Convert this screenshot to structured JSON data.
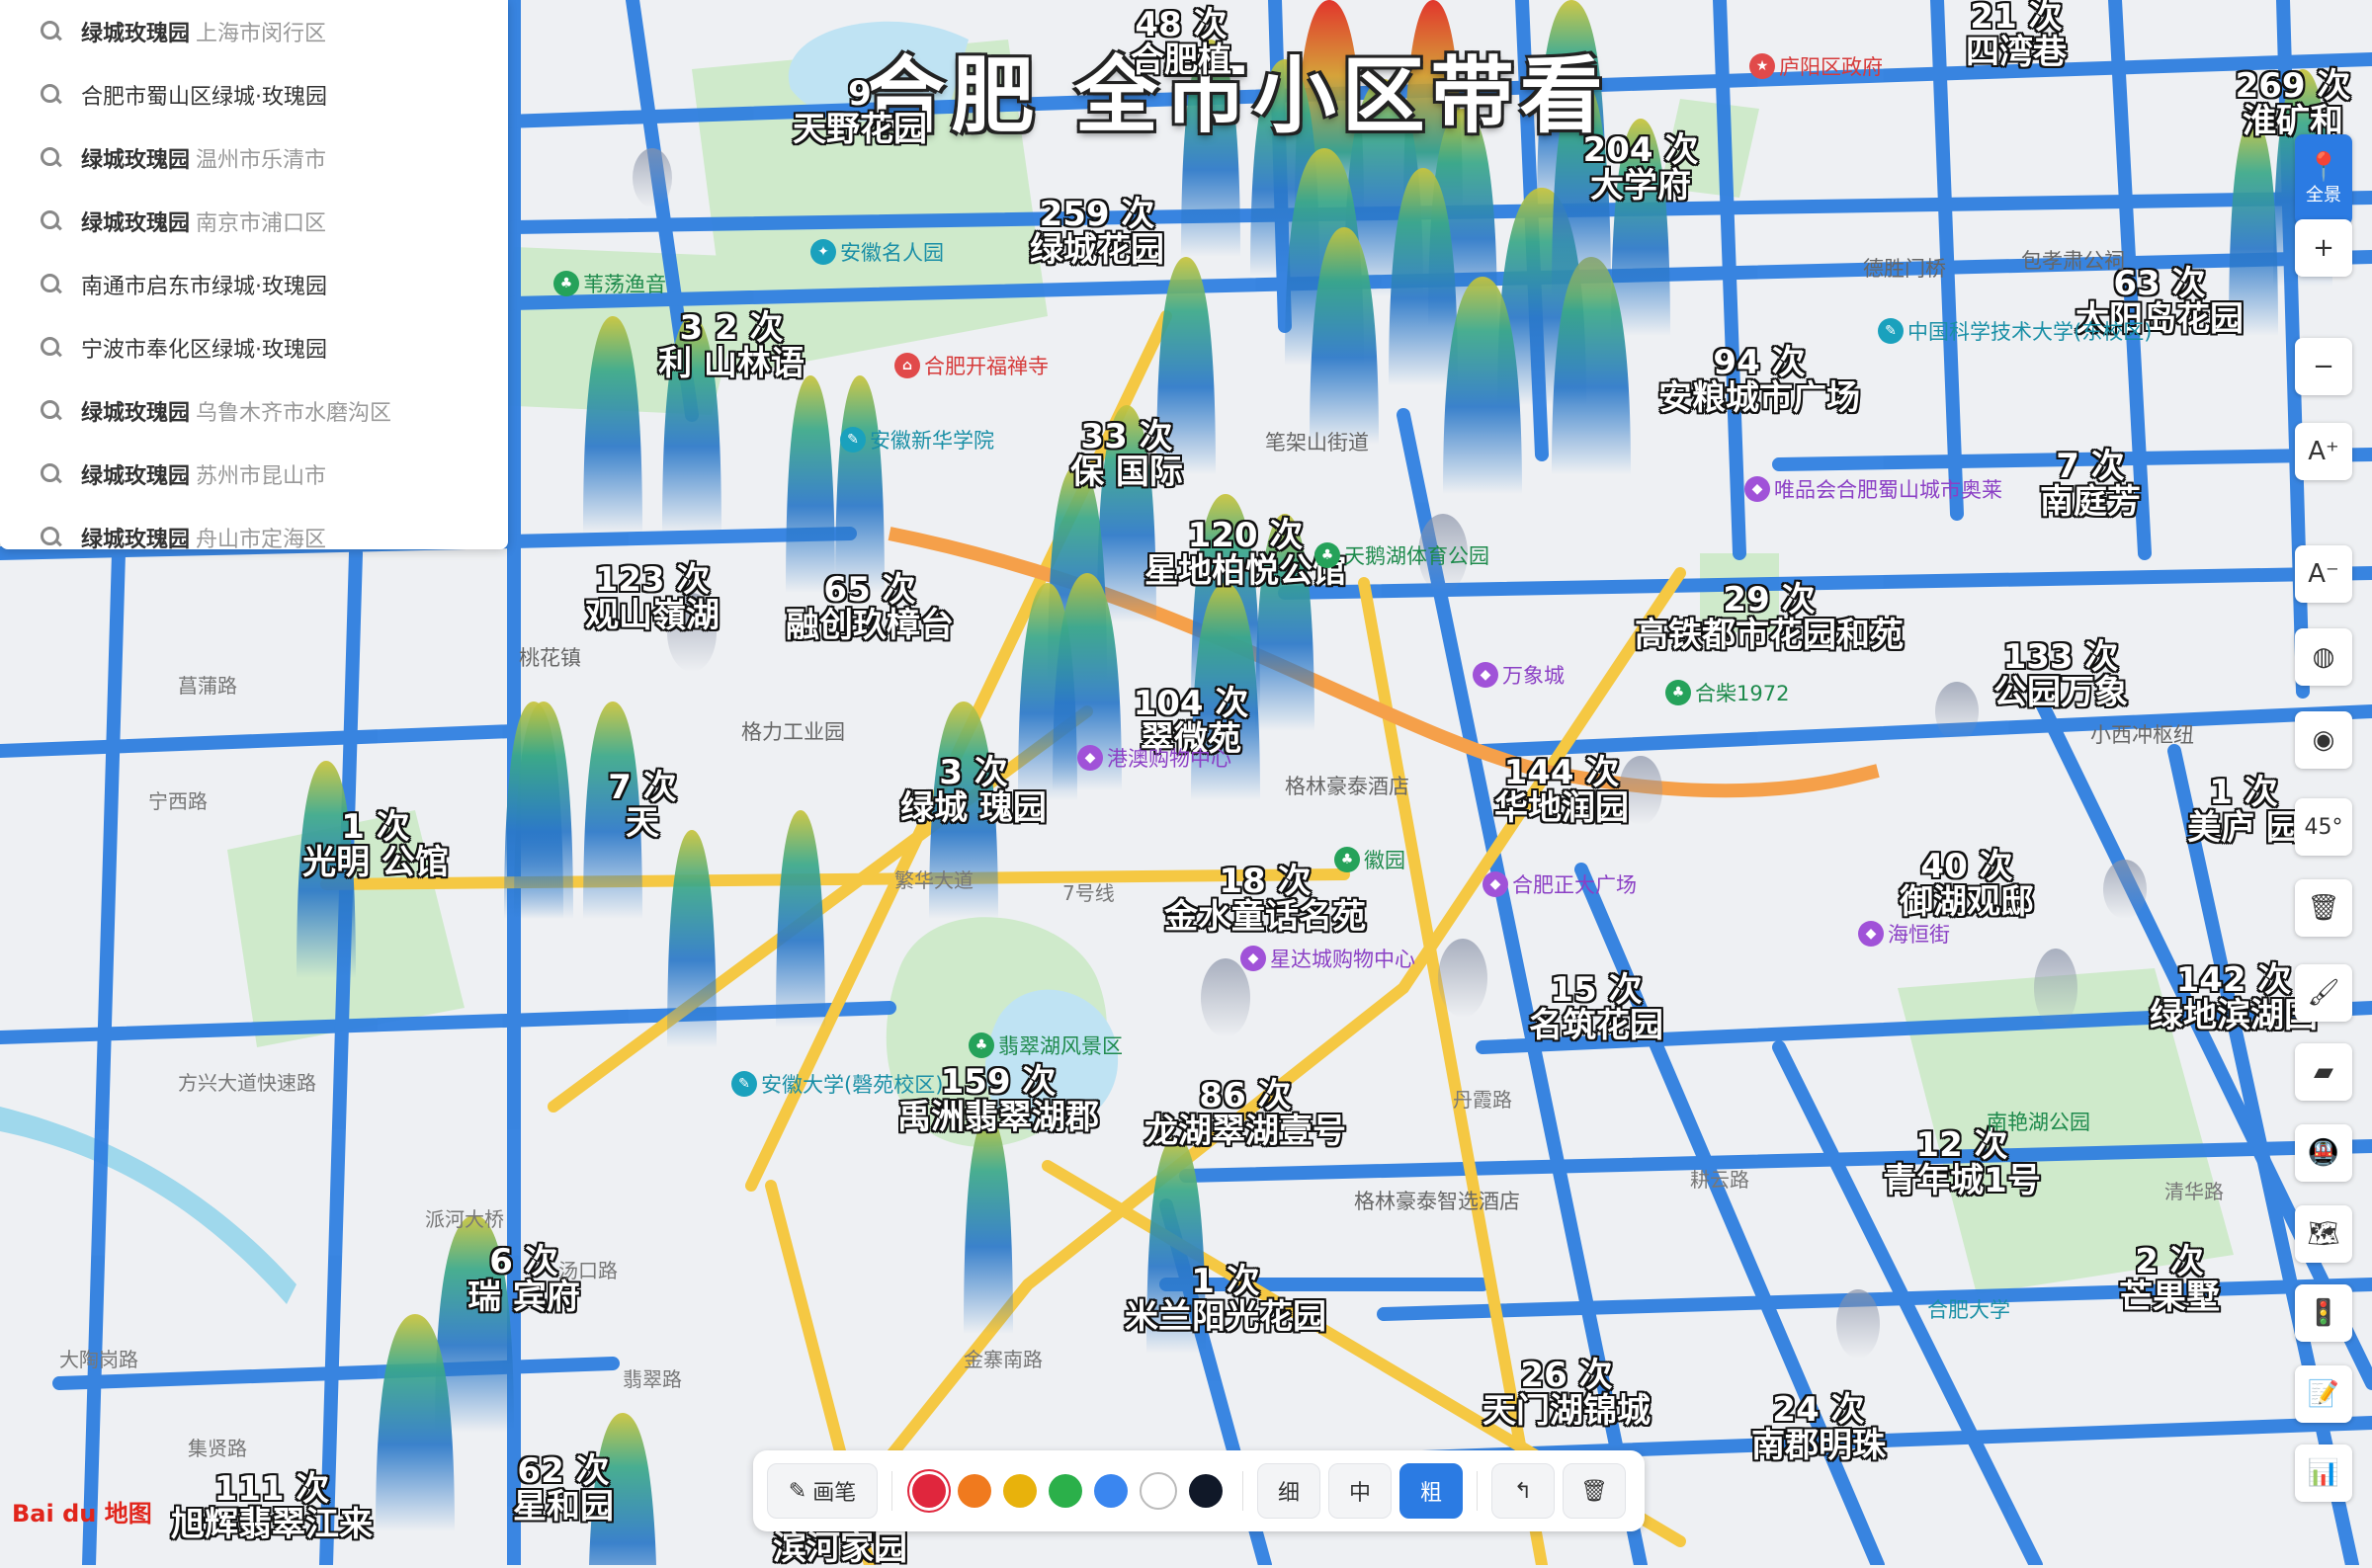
{
  "title": "合肥 全市小区带看",
  "search_suggestions": [
    {
      "bold": "绿城玫瑰园",
      "rest": "上海市闵行区"
    },
    {
      "bold": "",
      "rest": "合肥市蜀山区绿城·玫瑰园"
    },
    {
      "bold": "绿城玫瑰园",
      "rest": "温州市乐清市"
    },
    {
      "bold": "绿城玫瑰园",
      "rest": "南京市浦口区"
    },
    {
      "bold": "",
      "rest": "南通市启东市绿城·玫瑰园"
    },
    {
      "bold": "",
      "rest": "宁波市奉化区绿城·玫瑰园"
    },
    {
      "bold": "绿城玫瑰园",
      "rest": "乌鲁木齐市水磨沟区"
    },
    {
      "bold": "绿城玫瑰园",
      "rest": "苏州市昆山市"
    },
    {
      "bold": "绿城玫瑰园",
      "rest": "舟山市定海区"
    }
  ],
  "labels": [
    {
      "count": "48 次",
      "name": "合肥植"
    },
    {
      "count": "9",
      "name": "天野花园"
    },
    {
      "count": "21 次",
      "name": "四湾巷"
    },
    {
      "count": "269 次",
      "name": "淮矿和"
    },
    {
      "count": "204 次",
      "name": "大学府"
    },
    {
      "count": "259 次",
      "name": "绿城花园"
    },
    {
      "count": "3 2 次",
      "name": "利 山林语"
    },
    {
      "count": "63 次",
      "name": "太阳岛花园"
    },
    {
      "count": "94 次",
      "name": "安粮城市广场"
    },
    {
      "count": "33 次",
      "name": "保 国际"
    },
    {
      "count": "7 次",
      "name": "南庭芳"
    },
    {
      "count": "120 次",
      "name": "星地柏悦公馆"
    },
    {
      "count": "123 次",
      "name": "观山嶺湖"
    },
    {
      "count": "65 次",
      "name": "融创玖樟台"
    },
    {
      "count": "29 次",
      "name": "高铁都市花园和苑"
    },
    {
      "count": "133 次",
      "name": "公园万象"
    },
    {
      "count": "104 次",
      "name": "翠微苑"
    },
    {
      "count": "3 次",
      "name": "绿城 瑰园"
    },
    {
      "count": "144 次",
      "name": "华地润园"
    },
    {
      "count": "1 次",
      "name": "美庐 园"
    },
    {
      "count": "1 次",
      "name": "光明 公馆"
    },
    {
      "count": "7 次",
      "name": "天"
    },
    {
      "count": "18 次",
      "name": "金水童话名苑"
    },
    {
      "count": "40 次",
      "name": "御湖观邸"
    },
    {
      "count": "142 次",
      "name": "绿地滨湖国"
    },
    {
      "count": "15 次",
      "name": "名筑花园"
    },
    {
      "count": "159 次",
      "name": "禹洲翡翠湖郡"
    },
    {
      "count": "86 次",
      "name": "龙湖翠湖壹号"
    },
    {
      "count": "12 次",
      "name": "青年城1号"
    },
    {
      "count": "6 次",
      "name": "瑞 宾府"
    },
    {
      "count": "1 次",
      "name": "米兰阳光花园"
    },
    {
      "count": "2 次",
      "name": "芒果墅"
    },
    {
      "count": "26 次",
      "name": "天门湖锦城"
    },
    {
      "count": "24 次",
      "name": "南郡明珠"
    },
    {
      "count": "111 次",
      "name": "旭辉翡翠江来"
    },
    {
      "count": "62 次",
      "name": "星和园"
    },
    {
      "count": "",
      "name": "滨河家园"
    }
  ],
  "pois": [
    {
      "type": "gov",
      "icon": "★",
      "name": "庐阳区政府"
    },
    {
      "type": "edu",
      "icon": "✦",
      "name": "安徽名人园"
    },
    {
      "type": "park",
      "icon": "♣",
      "name": "苇荡渔音"
    },
    {
      "type": "gov",
      "icon": "⌂",
      "name": "合肥开福禅寺"
    },
    {
      "type": "edu",
      "icon": "✎",
      "name": "中国科学技术大学(东校区)"
    },
    {
      "type": "edu",
      "icon": "✎",
      "name": "安徽新华学院"
    },
    {
      "type": "shop",
      "icon": "◆",
      "name": "唯品会合肥蜀山城市奥莱"
    },
    {
      "type": "park",
      "icon": "♣",
      "name": "天鹅湖体育公园"
    },
    {
      "type": "shop",
      "icon": "◆",
      "name": "万象城"
    },
    {
      "type": "park",
      "icon": "♣",
      "name": "合柴1972"
    },
    {
      "type": "plain",
      "icon": "",
      "name": "格力工业园"
    },
    {
      "type": "shop",
      "icon": "◆",
      "name": "港澳购物中心"
    },
    {
      "type": "plain",
      "icon": "",
      "name": "格林豪泰酒店"
    },
    {
      "type": "park",
      "icon": "♣",
      "name": "徽园"
    },
    {
      "type": "shop",
      "icon": "◆",
      "name": "合肥正大广场"
    },
    {
      "type": "shop",
      "icon": "◆",
      "name": "星达城购物中心"
    },
    {
      "type": "shop",
      "icon": "◆",
      "name": "海恒街"
    },
    {
      "type": "park",
      "icon": "♣",
      "name": "翡翠湖风景区"
    },
    {
      "type": "edu",
      "icon": "✎",
      "name": "安徽大学(磬苑校区)"
    },
    {
      "type": "plain",
      "icon": "",
      "name": "格林豪泰智选酒店"
    },
    {
      "type": "park",
      "icon": "",
      "name": "南艳湖公园"
    },
    {
      "type": "edu",
      "icon": "",
      "name": "合肥大学"
    },
    {
      "type": "plain",
      "icon": "",
      "name": "笔架山街道"
    },
    {
      "type": "plain",
      "icon": "",
      "name": "桃花镇"
    },
    {
      "type": "plain",
      "icon": "",
      "name": "德胜门桥"
    },
    {
      "type": "plain",
      "icon": "",
      "name": "包孝肃公祠"
    },
    {
      "type": "plain",
      "icon": "",
      "name": "小西冲枢纽"
    },
    {
      "type": "road",
      "icon": "",
      "name": "繁华大道"
    },
    {
      "type": "road",
      "icon": "",
      "name": "丹霞路"
    },
    {
      "type": "road",
      "icon": "",
      "name": "耕云路"
    },
    {
      "type": "road",
      "icon": "",
      "name": "清华路"
    },
    {
      "type": "road",
      "icon": "",
      "name": "宁西路"
    },
    {
      "type": "road",
      "icon": "",
      "name": "菖蒲路"
    },
    {
      "type": "road",
      "icon": "",
      "name": "金寨南路"
    },
    {
      "type": "road",
      "icon": "",
      "name": "翡翠路"
    },
    {
      "type": "road",
      "icon": "",
      "name": "汤口路"
    },
    {
      "type": "road",
      "icon": "",
      "name": "派河大桥"
    },
    {
      "type": "road",
      "icon": "",
      "name": "大陶岗路"
    },
    {
      "type": "road",
      "icon": "",
      "name": "集贤路"
    },
    {
      "type": "road",
      "icon": "",
      "name": "方兴大道快速路"
    },
    {
      "type": "road",
      "icon": "",
      "name": "7号线"
    }
  ],
  "controls": {
    "full_view": "全景",
    "zoom_in": "+",
    "zoom_out": "−",
    "font_up": "A⁺",
    "font_down": "A⁻",
    "tilt": "45°"
  },
  "toolbar": {
    "pen": "画笔",
    "thin": "细",
    "medium": "中",
    "thick": "粗",
    "colors": [
      "#e0263d",
      "#f07a1e",
      "#e8b20c",
      "#2bb04a",
      "#3a86f0",
      "#ffffff",
      "#101828"
    ]
  },
  "logo": "Bai du 地图",
  "colors": {
    "road": "#2f7fe0",
    "arterial": "#f5c843",
    "park": "#cfeacb",
    "water": "#bfe3f3"
  }
}
